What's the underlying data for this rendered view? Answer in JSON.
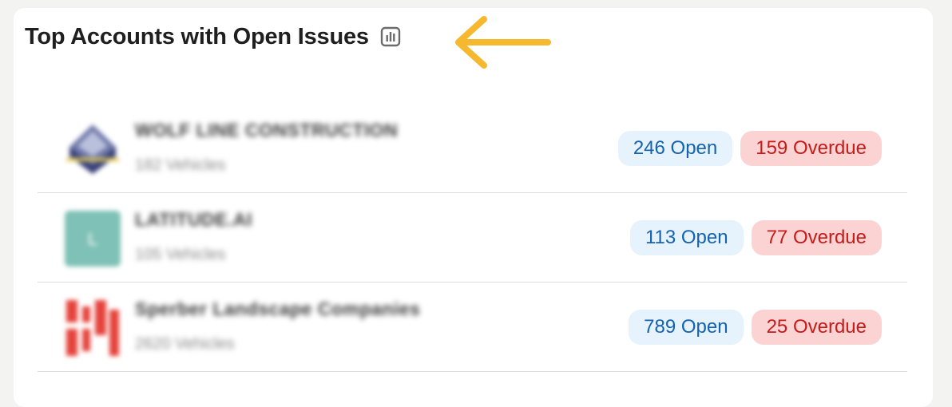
{
  "widget": {
    "title": "Top Accounts with Open Issues",
    "chart_icon": "bar-chart-icon",
    "annotation_icon": "arrow-left-icon",
    "annotation_color": "#F5B82E"
  },
  "accounts": [
    {
      "name": "WOLF LINE CONSTRUCTION",
      "vehicles": "182 Vehicles",
      "open": "246 Open",
      "overdue": "159 Overdue"
    },
    {
      "name": "LATITUDE.AI",
      "vehicles": "105 Vehicles",
      "logo_letter": "L",
      "open": "113 Open",
      "overdue": "77 Overdue"
    },
    {
      "name": "Sperber Landscape Companies",
      "vehicles": "2620 Vehicles",
      "open": "789 Open",
      "overdue": "25 Overdue"
    }
  ],
  "colors": {
    "open_text": "#1463B1",
    "open_bg": "#E6F2FC",
    "overdue_text": "#C51B1B",
    "overdue_bg": "#FBD3D3"
  }
}
